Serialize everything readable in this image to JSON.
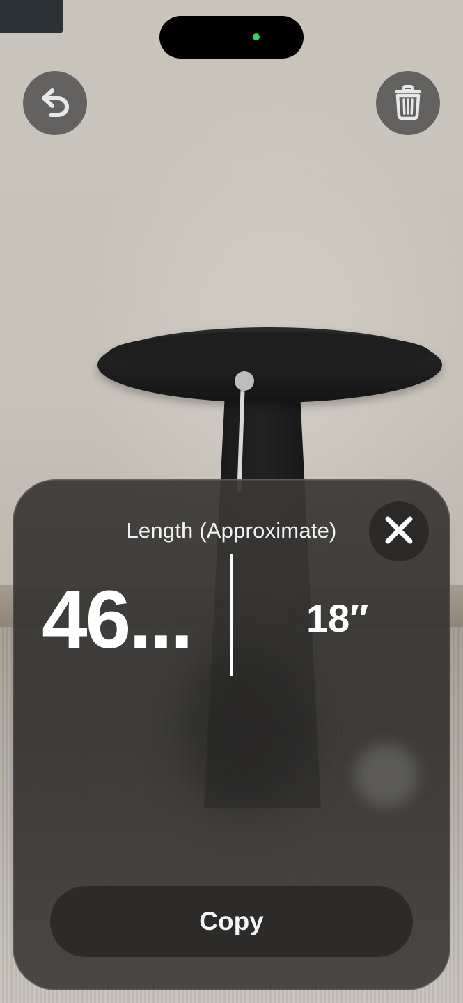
{
  "sheet": {
    "title": "Length (Approximate)",
    "primary_value": "46...",
    "secondary_value": "18″",
    "copy_label": "Copy"
  },
  "icons": {
    "undo": "undo-arrow-icon",
    "trash": "trash-icon",
    "close": "close-x-icon"
  },
  "status": {
    "camera_indicator_color": "#32d74b"
  }
}
